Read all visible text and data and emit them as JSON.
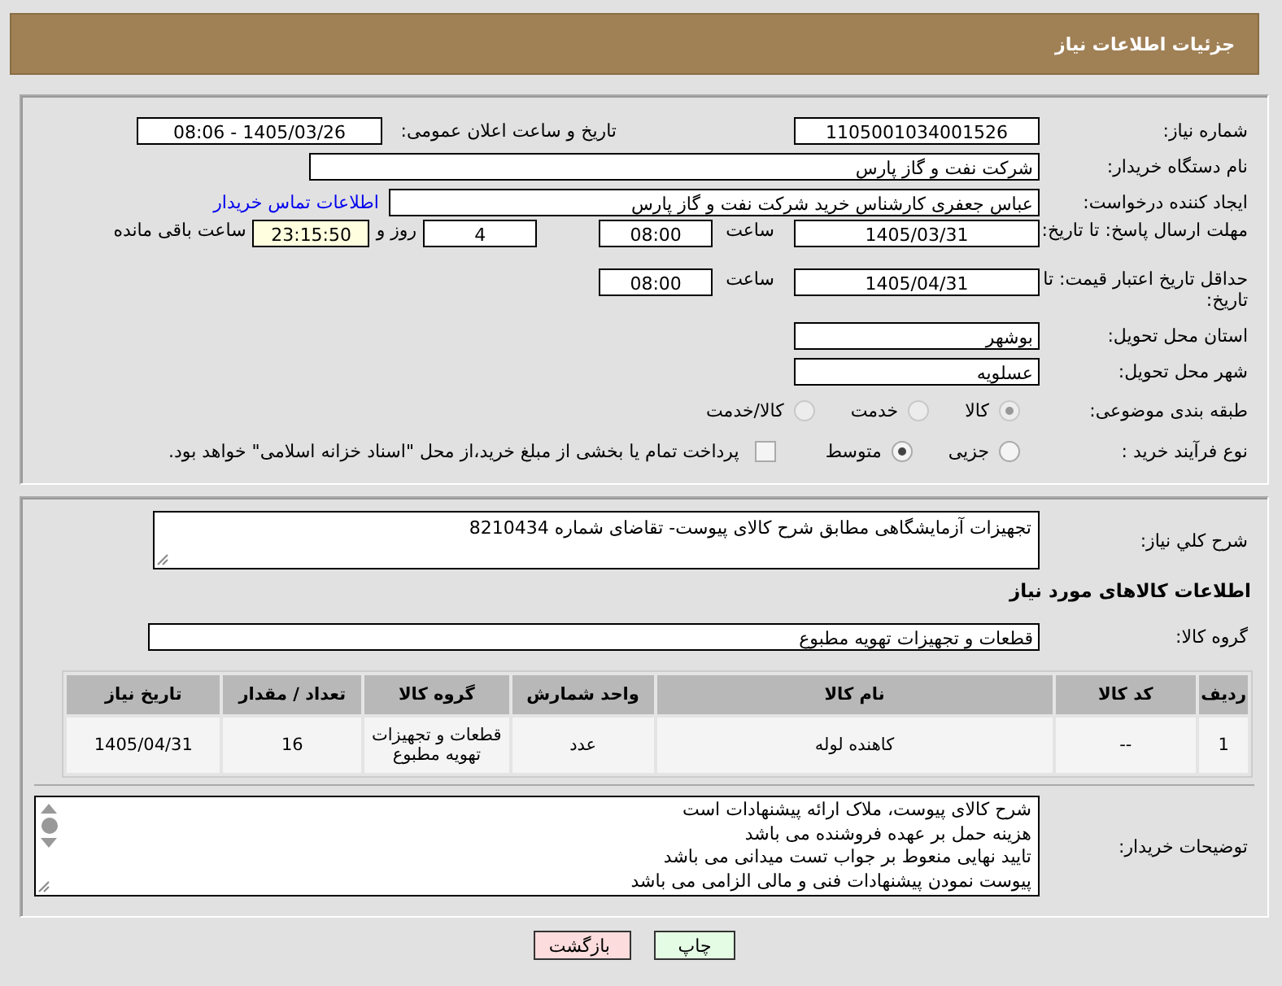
{
  "header": {
    "title": "جزئیات اطلاعات نیاز"
  },
  "need_number": {
    "label": "شماره نیاز:",
    "value": "1105001034001526"
  },
  "announce": {
    "label": "تاریخ و ساعت اعلان عمومی:",
    "value": "1405/03/26 - 08:06"
  },
  "buyer_org": {
    "label": "نام دستگاه خریدار:",
    "value": "شرکت نفت و گاز پارس"
  },
  "requester": {
    "label": "ایجاد کننده درخواست:",
    "value": "عباس  جعفری کارشناس خرید  شرکت نفت و گاز پارس",
    "link": "اطلاعات تماس خریدار"
  },
  "reply_deadline": {
    "label": "مهلت ارسال پاسخ: تا تاریخ:",
    "date": "1405/03/31",
    "time_label": "ساعت",
    "time": "08:00",
    "days": "4",
    "days_label": "روز و",
    "remaining": "23:15:50",
    "remaining_label": "ساعت باقی مانده"
  },
  "price_validity": {
    "label": "حداقل تاریخ اعتبار قیمت: تا تاریخ:",
    "date": "1405/04/31",
    "time_label": "ساعت",
    "time": "08:00"
  },
  "province": {
    "label": "استان محل تحویل:",
    "value": "بوشهر"
  },
  "city": {
    "label": "شهر محل تحویل:",
    "value": "عسلویه"
  },
  "category": {
    "label": "طبقه بندی موضوعی:",
    "disabled": true,
    "options": [
      {
        "label": "کالا",
        "selected": true
      },
      {
        "label": "خدمت",
        "selected": false
      },
      {
        "label": "کالا/خدمت",
        "selected": false
      }
    ]
  },
  "process": {
    "label": "نوع فرآیند خرید :",
    "options": [
      {
        "label": "جزیی",
        "selected": false
      },
      {
        "label": "متوسط",
        "selected": true
      }
    ],
    "payment": {
      "checked": false,
      "label": "پرداخت تمام یا بخشی از مبلغ خرید،از محل \"اسناد خزانه اسلامی\" خواهد بود."
    }
  },
  "description": {
    "label": "شرح کلي نیاز:",
    "value": "تجهیزات آزمایشگاهی مطابق شرح کالای پیوست- تقاضای شماره 8210434"
  },
  "goods_heading": "اطلاعات کالاهای مورد نیاز",
  "goods_group": {
    "label": "گروه کالا:",
    "value": "قطعات و تجهیزات تهویه مطبوع"
  },
  "table": {
    "columns": [
      "ردیف",
      "کد کالا",
      "نام کالا",
      "واحد شمارش",
      "گروه کالا",
      "تعداد / مقدار",
      "تاریخ نیاز"
    ],
    "rows": [
      [
        "1",
        "--",
        "کاهنده لوله",
        "عدد",
        "قطعات و تجهیزات تهویه مطبوع",
        "16",
        "1405/04/31"
      ]
    ]
  },
  "buyer_notes": {
    "label": "توضیحات خریدار:",
    "lines": [
      "شرح کالای پیوست، ملاک ارائه پیشنهادات است",
      "هزینه حمل بر عهده فروشنده می باشد",
      "تایید نهایی منعوط بر جواب تست میدانی می باشد",
      "پیوست نمودن پیشنهادات فنی و مالی الزامی می باشد"
    ]
  },
  "buttons": [
    {
      "label": "چاپ",
      "kind": "print"
    },
    {
      "label": "بازگشت",
      "kind": "back"
    }
  ]
}
